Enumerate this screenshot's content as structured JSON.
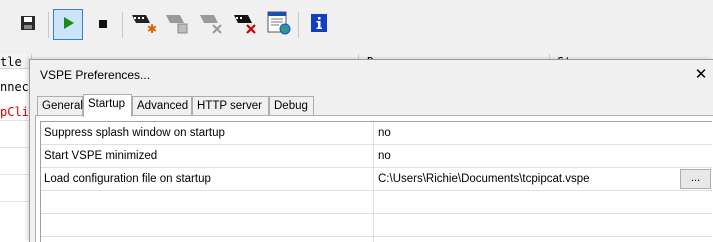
{
  "toolbar": {
    "icons": [
      "save-icon",
      "play-icon",
      "stop-icon",
      "new-device-icon",
      "edit-device-icon",
      "remove-device-icon",
      "delete-device-icon",
      "settings-icon",
      "info-icon"
    ]
  },
  "background": {
    "col1_header": "tle",
    "col2_header": "D",
    "col3_header": "St",
    "row1": "nnect",
    "row2": "pClie"
  },
  "dialog": {
    "title": "VSPE Preferences...",
    "close_glyph": "✕",
    "tabs": [
      {
        "label": "General"
      },
      {
        "label": "Startup"
      },
      {
        "label": "Advanced"
      },
      {
        "label": "HTTP server"
      },
      {
        "label": "Debug"
      }
    ],
    "selected_tab": "Startup",
    "rows": [
      {
        "name": "Suppress splash window on startup",
        "value": "no"
      },
      {
        "name": "Start VSPE minimized",
        "value": "no"
      },
      {
        "name": "Load configuration file on startup",
        "value": "C:\\Users\\Richie\\Documents\\tcpipcat.vspe"
      }
    ],
    "browse_label": "..."
  },
  "colors": {
    "accent": "#3a7fc6",
    "play_green": "#1a8a1a",
    "error_red": "#cc0000",
    "info_blue": "#1040c0"
  }
}
